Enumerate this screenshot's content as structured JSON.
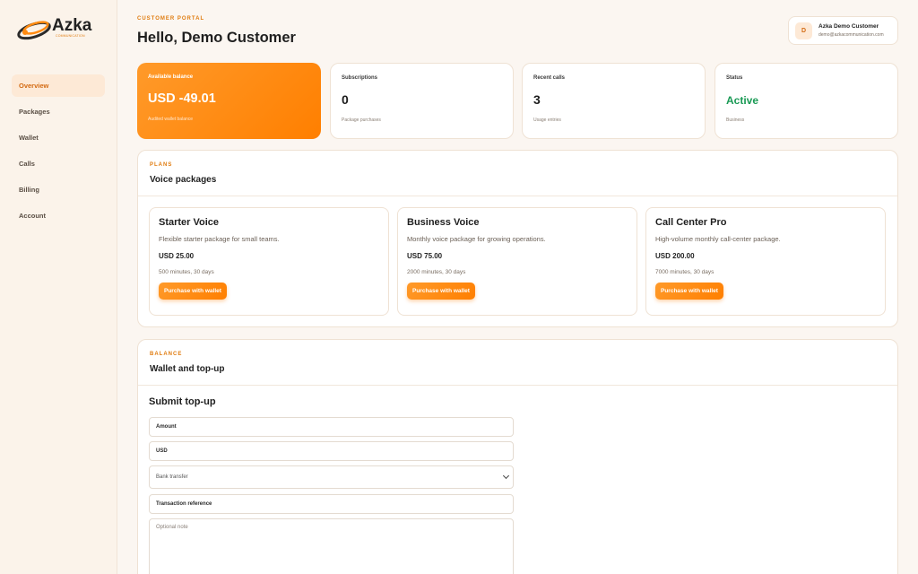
{
  "brand": {
    "name": "Azka",
    "tagline": "COMMUNICATION"
  },
  "sidebar": {
    "items": [
      {
        "label": "Overview",
        "active": true
      },
      {
        "label": "Packages",
        "active": false
      },
      {
        "label": "Wallet",
        "active": false
      },
      {
        "label": "Calls",
        "active": false
      },
      {
        "label": "Billing",
        "active": false
      },
      {
        "label": "Account",
        "active": false
      }
    ]
  },
  "header": {
    "eyebrow": "CUSTOMER PORTAL",
    "greeting": "Hello, Demo Customer",
    "user": {
      "initial": "D",
      "name": "Azka Demo Customer",
      "email": "demo@azkacommunication.com"
    }
  },
  "stats": [
    {
      "label": "Available balance",
      "value": "USD -49.01",
      "sub": "Audited wallet balance"
    },
    {
      "label": "Subscriptions",
      "value": "0",
      "sub": "Package purchases"
    },
    {
      "label": "Recent calls",
      "value": "3",
      "sub": "Usage entries"
    },
    {
      "label": "Status",
      "value": "Active",
      "sub": "Business"
    }
  ],
  "plans": {
    "eyebrow": "PLANS",
    "title": "Voice packages",
    "packages": [
      {
        "name": "Starter Voice",
        "desc": "Flexible starter package for small teams.",
        "price": "USD 25.00",
        "meta": "500 minutes, 30 days",
        "button": "Purchase with wallet"
      },
      {
        "name": "Business Voice",
        "desc": "Monthly voice package for growing operations.",
        "price": "USD 75.00",
        "meta": "2000 minutes, 30 days",
        "button": "Purchase with wallet"
      },
      {
        "name": "Call Center Pro",
        "desc": "High-volume monthly call-center package.",
        "price": "USD 200.00",
        "meta": "7000 minutes, 30 days",
        "button": "Purchase with wallet"
      }
    ]
  },
  "wallet": {
    "eyebrow": "BALANCE",
    "title": "Wallet and top-up",
    "form_title": "Submit top-up",
    "amount_placeholder": "Amount",
    "currency_value": "USD",
    "method_value": "Bank transfer",
    "reference_placeholder": "Transaction reference",
    "note_placeholder": "Optional note"
  },
  "colors": {
    "accent": "#ff8a10",
    "active_green": "#1a9a55",
    "page_bg": "#fbf6f1"
  }
}
